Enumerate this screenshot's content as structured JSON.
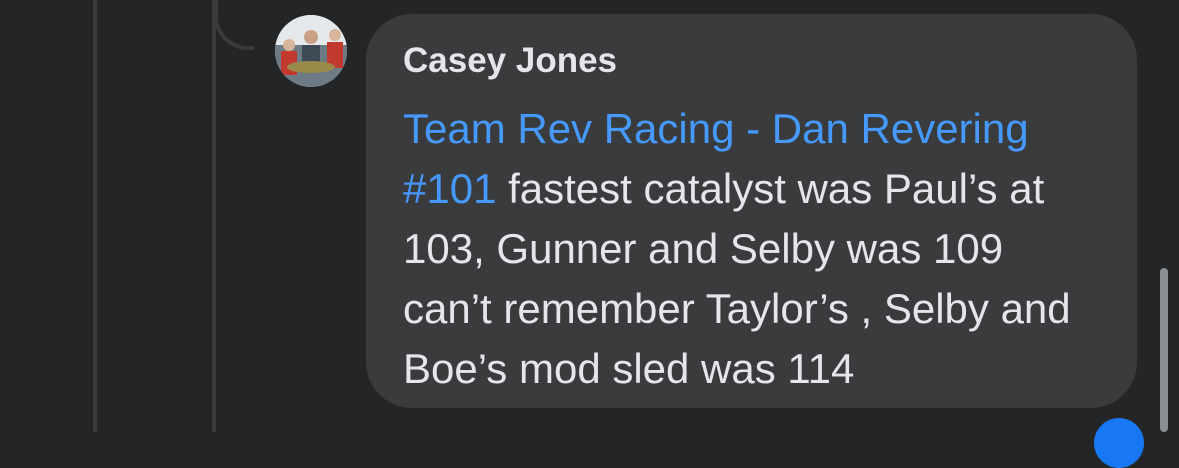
{
  "comment": {
    "author": "Casey Jones",
    "tag_text": "Team Rev Racing - Dan Revering #101",
    "body": " fastest catalyst was Paul’s at 103, Gunner and Selby was 109 can’t remember Taylor’s , Selby and Boe’s mod sled was 114"
  },
  "colors": {
    "background": "#242526",
    "bubble": "#3a3b3c",
    "text": "#e4e6eb",
    "link": "#4599ff"
  },
  "icons": [
    "thread-line",
    "avatar",
    "reaction-badge"
  ]
}
